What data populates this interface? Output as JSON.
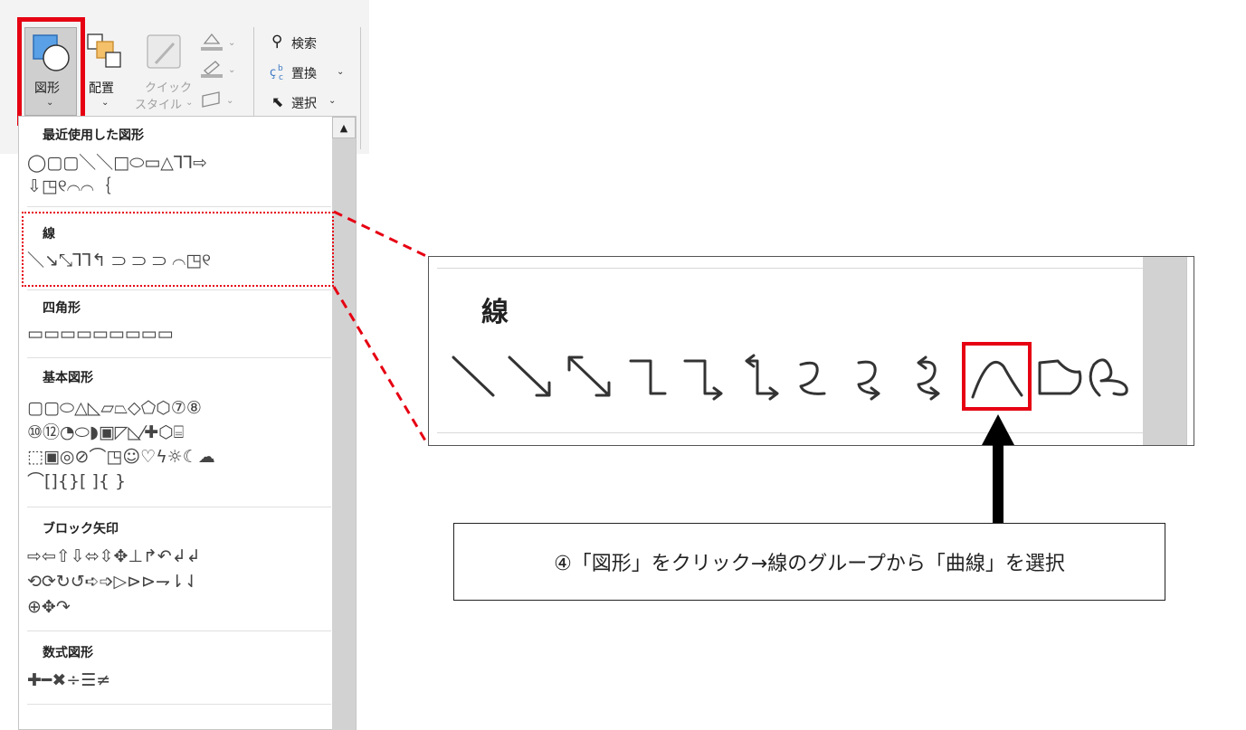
{
  "ribbon": {
    "shapes_label": "図形",
    "arrange_label": "配置",
    "quick_style_label_1": "クイック",
    "quick_style_label_2": "スタイル",
    "find_label": "検索",
    "replace_label": "置換",
    "select_label": "選択"
  },
  "panel": {
    "sections": [
      {
        "title": "最近使用した図形",
        "rows": [
          "◯▢▢＼＼□⬭▭△⅂⅂⇨",
          "⇩◳୧⌒⌒｛"
        ]
      },
      {
        "title": "線",
        "rows": [
          "＼↘⤡⅂⅂↰ ⸧ ⸧ ⸧ ⌒◳୧"
        ]
      },
      {
        "title": "四角形",
        "rows": [
          "▭▭▭▭▭▭▭▭▭"
        ]
      },
      {
        "title": "基本図形",
        "rows": [
          "▢▢⬭△◺▱⏢◇⬠⬡⑦⑧",
          "⑩⑫◔⬭◗▣◸◺⁄✚⬡⌸",
          "⬚▣◎⊘⌒◳☺♡ϟ☼☾☁",
          "⌒[]{}[ ]{ }"
        ]
      },
      {
        "title": "ブロック矢印",
        "rows": [
          "⇨⇦⇧⇩⬄⇳✥⊥↱↶↲↲",
          "⟲⟳↻↺➪➩▷⊳⊳⇁⇂⇃",
          "⊕✥↷"
        ]
      },
      {
        "title": "数式図形",
        "rows": [
          "✚━✖÷☰≠"
        ]
      }
    ],
    "scroll_up_icon": "▲"
  },
  "zoom": {
    "title": "線",
    "row": "＼↘⤡⅂⅂↰ ⸧ ⸧ ⸧ ⌒◳୧"
  },
  "caption": "④「図形」をクリック→線のグループから「曲線」を選択",
  "colors": {
    "highlight": "#e60012",
    "ribbon_bg": "#f3f3f3",
    "scroll": "#d2d2d2"
  }
}
